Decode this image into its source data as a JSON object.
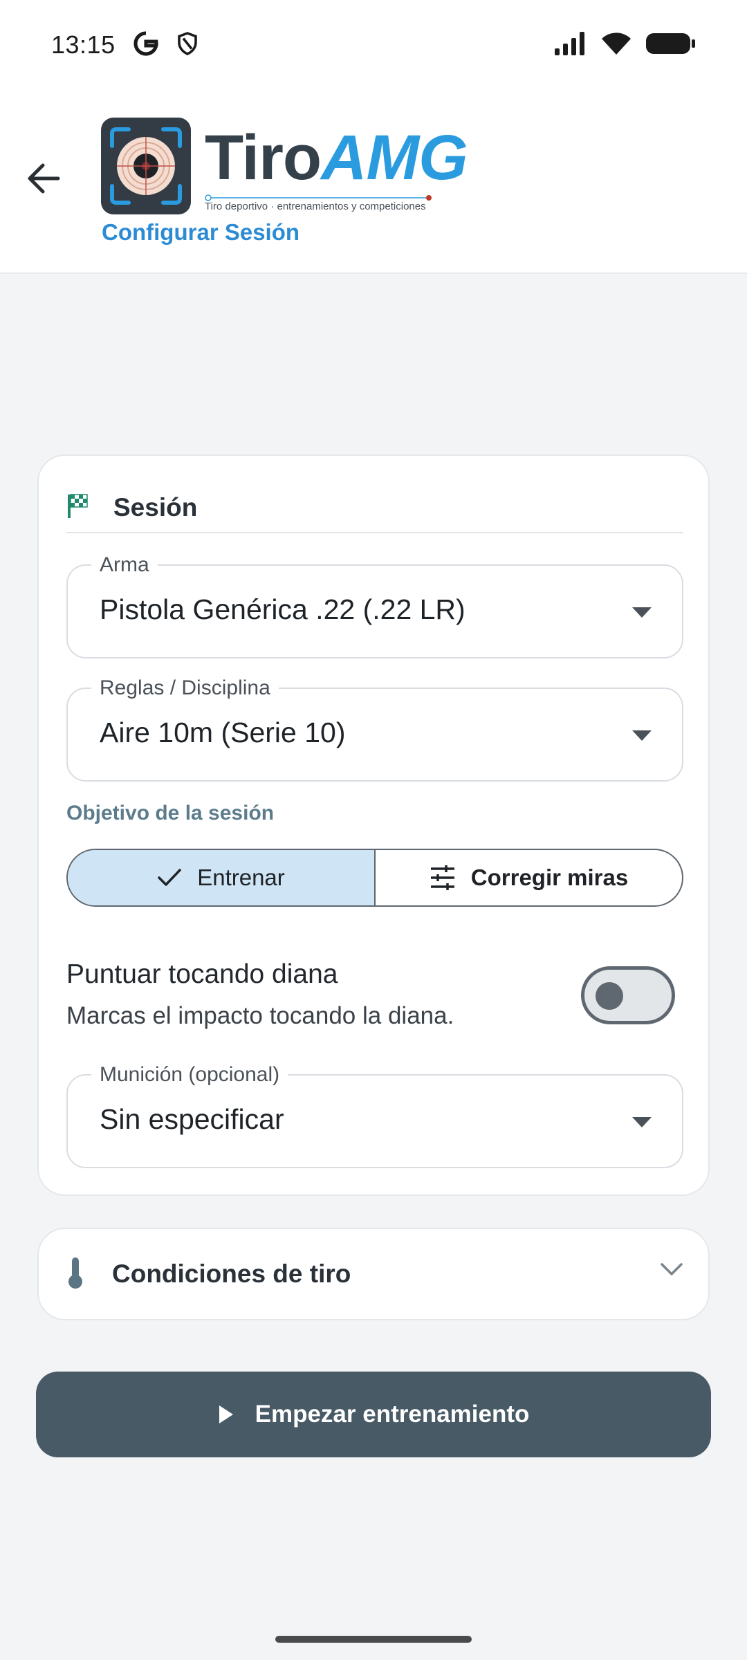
{
  "status_bar": {
    "time": "13:15",
    "icons": [
      "google-icon",
      "shield-icon",
      "signal-icon",
      "wifi-icon",
      "battery-icon"
    ]
  },
  "app_bar": {
    "back_icon": "arrow-left-icon",
    "logo": {
      "title_part1": "Tiro",
      "title_part2": "AMG",
      "subtitle": "Tiro deportivo · entrenamientos y competiciones"
    },
    "page_title": "Configurar Sesión"
  },
  "session_card": {
    "icon": "checkered-flag-icon",
    "title": "Sesión",
    "weapon": {
      "label": "Arma",
      "value": "Pistola Genérica .22 (.22 LR)"
    },
    "rules": {
      "label": "Reglas / Disciplina",
      "value": "Aire 10m (Serie 10)"
    },
    "objective": {
      "label": "Objetivo de la sesión",
      "options": [
        {
          "label": "Entrenar",
          "icon": "check-icon",
          "selected": true
        },
        {
          "label": "Corregir miras",
          "icon": "tune-icon",
          "selected": false
        }
      ]
    },
    "touch_scoring": {
      "title": "Puntuar tocando diana",
      "subtitle": "Marcas el impacto tocando la diana.",
      "enabled": false
    },
    "ammo": {
      "label": "Munición (opcional)",
      "value": "Sin especificar"
    }
  },
  "conditions_card": {
    "icon": "thermometer-icon",
    "title": "Condiciones de tiro",
    "expand_icon": "chevron-down-icon"
  },
  "start_button": {
    "icon": "play-icon",
    "label": "Empezar entrenamiento"
  },
  "colors": {
    "accent_blue": "#2d8bd4",
    "segment_selected": "#cfe4f4",
    "start_button": "#475a66",
    "flag_green": "#1f8a6e"
  }
}
